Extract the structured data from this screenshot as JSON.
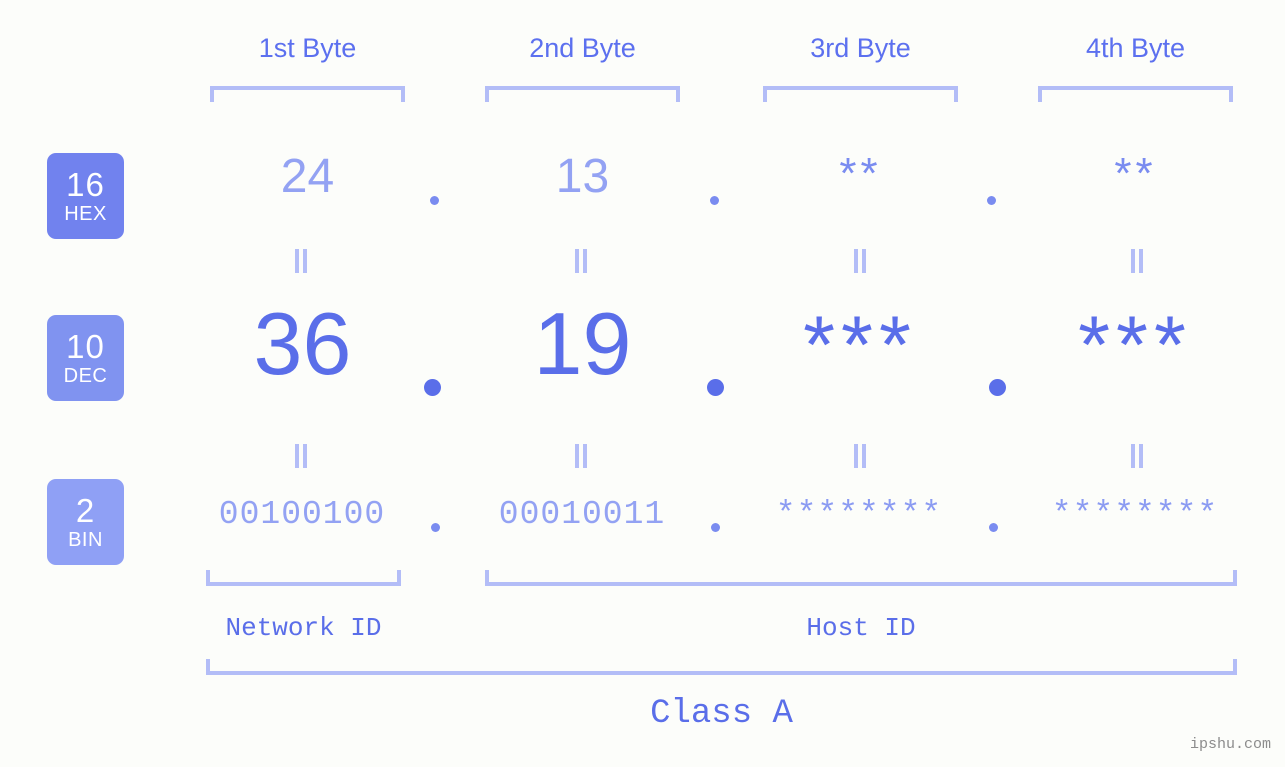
{
  "meta": {
    "background": "#fcfdfa",
    "accent_strong": "#5a6ee9",
    "accent_mid": "#7a8cf0",
    "accent_light": "#93a2f3",
    "bracket": "#b3bdf7"
  },
  "byte_headers": [
    {
      "label": "1st Byte"
    },
    {
      "label": "2nd Byte"
    },
    {
      "label": "3rd Byte"
    },
    {
      "label": "4th Byte"
    }
  ],
  "radix_badges": [
    {
      "number": "16",
      "name": "HEX",
      "color": "#7182ee"
    },
    {
      "number": "10",
      "name": "DEC",
      "color": "#8093f0"
    },
    {
      "number": "2",
      "name": "BIN",
      "color": "#8fa0f5"
    }
  ],
  "rows": {
    "hex": {
      "radix": "16",
      "radix_name": "HEX",
      "values": [
        "24",
        "13",
        "**",
        "**"
      ],
      "separator": "."
    },
    "dec": {
      "radix": "10",
      "radix_name": "DEC",
      "values": [
        "36",
        "19",
        "***",
        "***"
      ],
      "separator": "."
    },
    "bin": {
      "radix": "2",
      "radix_name": "BIN",
      "values": [
        "00100100",
        "00010011",
        "********",
        "********"
      ],
      "separator": "."
    }
  },
  "equals_marks": {
    "symbol": "=",
    "count_row1": 4,
    "count_row2": 4
  },
  "sections": [
    {
      "label": "Network ID",
      "bytes": "1"
    },
    {
      "label": "Host ID",
      "bytes": "2-4"
    }
  ],
  "class": {
    "label": "Class A"
  },
  "watermark": {
    "text": "ipshu.com"
  }
}
